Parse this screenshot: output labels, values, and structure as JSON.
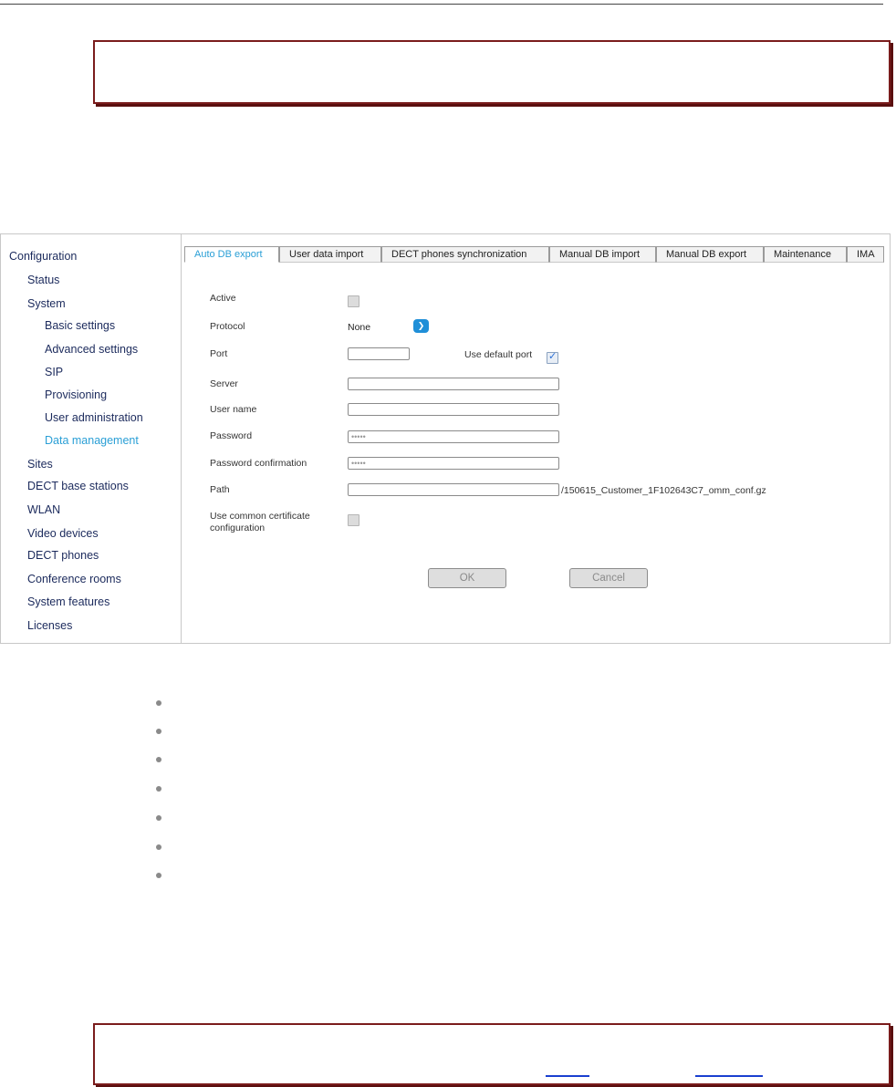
{
  "sidebar": {
    "items": [
      {
        "label": "Configuration"
      },
      {
        "label": "Status"
      },
      {
        "label": "System"
      },
      {
        "label": "Basic settings"
      },
      {
        "label": "Advanced settings"
      },
      {
        "label": "SIP"
      },
      {
        "label": "Provisioning"
      },
      {
        "label": "User administration"
      },
      {
        "label": "Data management"
      },
      {
        "label": "Sites"
      },
      {
        "label": "DECT base stations"
      },
      {
        "label": "WLAN"
      },
      {
        "label": "Video devices"
      },
      {
        "label": "DECT phones"
      },
      {
        "label": "Conference rooms"
      },
      {
        "label": "System features"
      },
      {
        "label": "Licenses"
      }
    ]
  },
  "tabs": [
    {
      "label": "Auto DB export"
    },
    {
      "label": "User data import"
    },
    {
      "label": "DECT phones synchronization"
    },
    {
      "label": "Manual DB import"
    },
    {
      "label": "Manual DB export"
    },
    {
      "label": "Maintenance"
    },
    {
      "label": "IMA"
    }
  ],
  "form": {
    "active_label": "Active",
    "protocol_label": "Protocol",
    "protocol_value": "None",
    "port_label": "Port",
    "port_value": "",
    "use_default_port_label": "Use default port",
    "server_label": "Server",
    "server_value": "",
    "username_label": "User name",
    "username_value": "",
    "password_label": "Password",
    "password_value": "•••••",
    "password_confirm_label": "Password confirmation",
    "password_confirm_value": "•••••",
    "path_label": "Path",
    "path_value": "",
    "path_suffix": "/150615_Customer_1F102643C7_omm_conf.gz",
    "common_cert_label_1": "Use common certificate",
    "common_cert_label_2": "configuration",
    "ok_label": "OK",
    "cancel_label": "Cancel"
  },
  "state": {
    "active_checked": false,
    "use_default_port_checked": true,
    "common_cert_checked": false
  },
  "colors": {
    "accent": "#2a9fd6",
    "note_border": "#7a1c1c",
    "nav_text": "#1b2a5c"
  }
}
